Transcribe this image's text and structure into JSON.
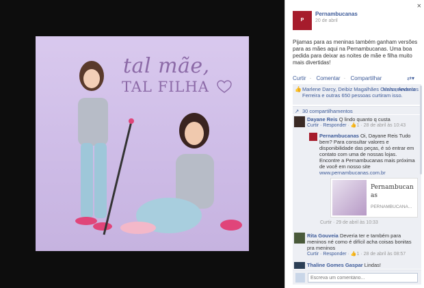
{
  "photo": {
    "title_line1": "tal mãe,",
    "title_line2": "TAL FILHA"
  },
  "sidebar": {
    "close_glyph": "×",
    "page_name": "Pernambucanas",
    "page_logo_text": "P",
    "post_date": "20 de abril",
    "post_text": "Pijamas para as meninas também ganham versões para as mães aqui na Pernambucanas. Uma boa pedida para deixar as noites de mãe e filha muito mais divertidas!",
    "actions": {
      "like": "Curtir",
      "comment": "Comentar",
      "share": "Compartilhar"
    },
    "likes_text": "Marlene Darcy, Deibiz Magalhães Cunha, Andreia Ferreira e outras 650 pessoas curtiram isso.",
    "relevant_label": "Mais relevantes",
    "shares_text": "30 compartilhamentos",
    "comments": [
      {
        "name": "Dayane Reis",
        "text": "Q lindo quanto q custa",
        "reply_label": "Curtir · Responder",
        "likes": "1",
        "time": "28 de abril às 10:43"
      },
      {
        "name": "Pernambucanas",
        "text": "Oi, Dayane Reis Tudo bem? Para consultar valores e disponibilidade das peças, é só entrar em contato com uma de nossas lojas. Encontre a Pernambucanas mais próxima de você em nosso site",
        "link": "www.pernambucanas.com.br",
        "card_title": "Pernambucan",
        "card_sub": "as",
        "card_domain": "PERNAMBUCANA...",
        "meta": "Curtir · 29 de abril às 10:33"
      },
      {
        "name": "Rita Gouveia",
        "text": "Deveria ter e também para meninos né como é difícil acha coisas bonitas pra meninos",
        "reply_label": "Curtir · Responder",
        "likes": "1",
        "time": "28 de abril às 08:57"
      },
      {
        "name": "Thaline Gomes Gaspar",
        "text": "Lindas!"
      }
    ],
    "comment_placeholder": "Escreva um comentário..."
  }
}
